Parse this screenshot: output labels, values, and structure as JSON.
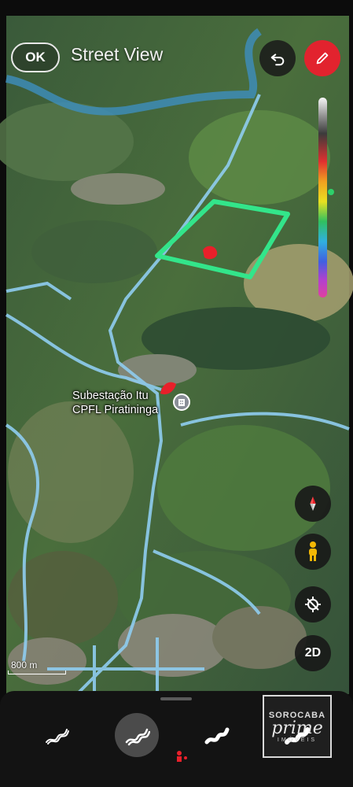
{
  "header": {
    "done_label": "OK",
    "title": "Street View"
  },
  "map": {
    "poi": {
      "name_line1": "Subestação Itu",
      "name_line2": "CPFL Piratininga",
      "icon": "building-icon"
    },
    "scale_label": "800 m",
    "drawing": {
      "outline_color": "#33e58a",
      "marks_color": "#e8202a"
    }
  },
  "controls": {
    "undo_icon": "undo-icon",
    "pen_icon": "pen-icon",
    "compass_icon": "compass-icon",
    "pegman_icon": "pegman-icon",
    "recenter_icon": "recenter-icon",
    "view_toggle_label": "2D"
  },
  "brush_panel": {
    "brushes": [
      "pen-brush",
      "marker-brush",
      "highlighter-brush",
      "pattern-brush"
    ],
    "selected_index": 1
  },
  "watermark": {
    "top": "SOROCABA",
    "middle": "prime",
    "bottom": "IMÓVEIS"
  }
}
